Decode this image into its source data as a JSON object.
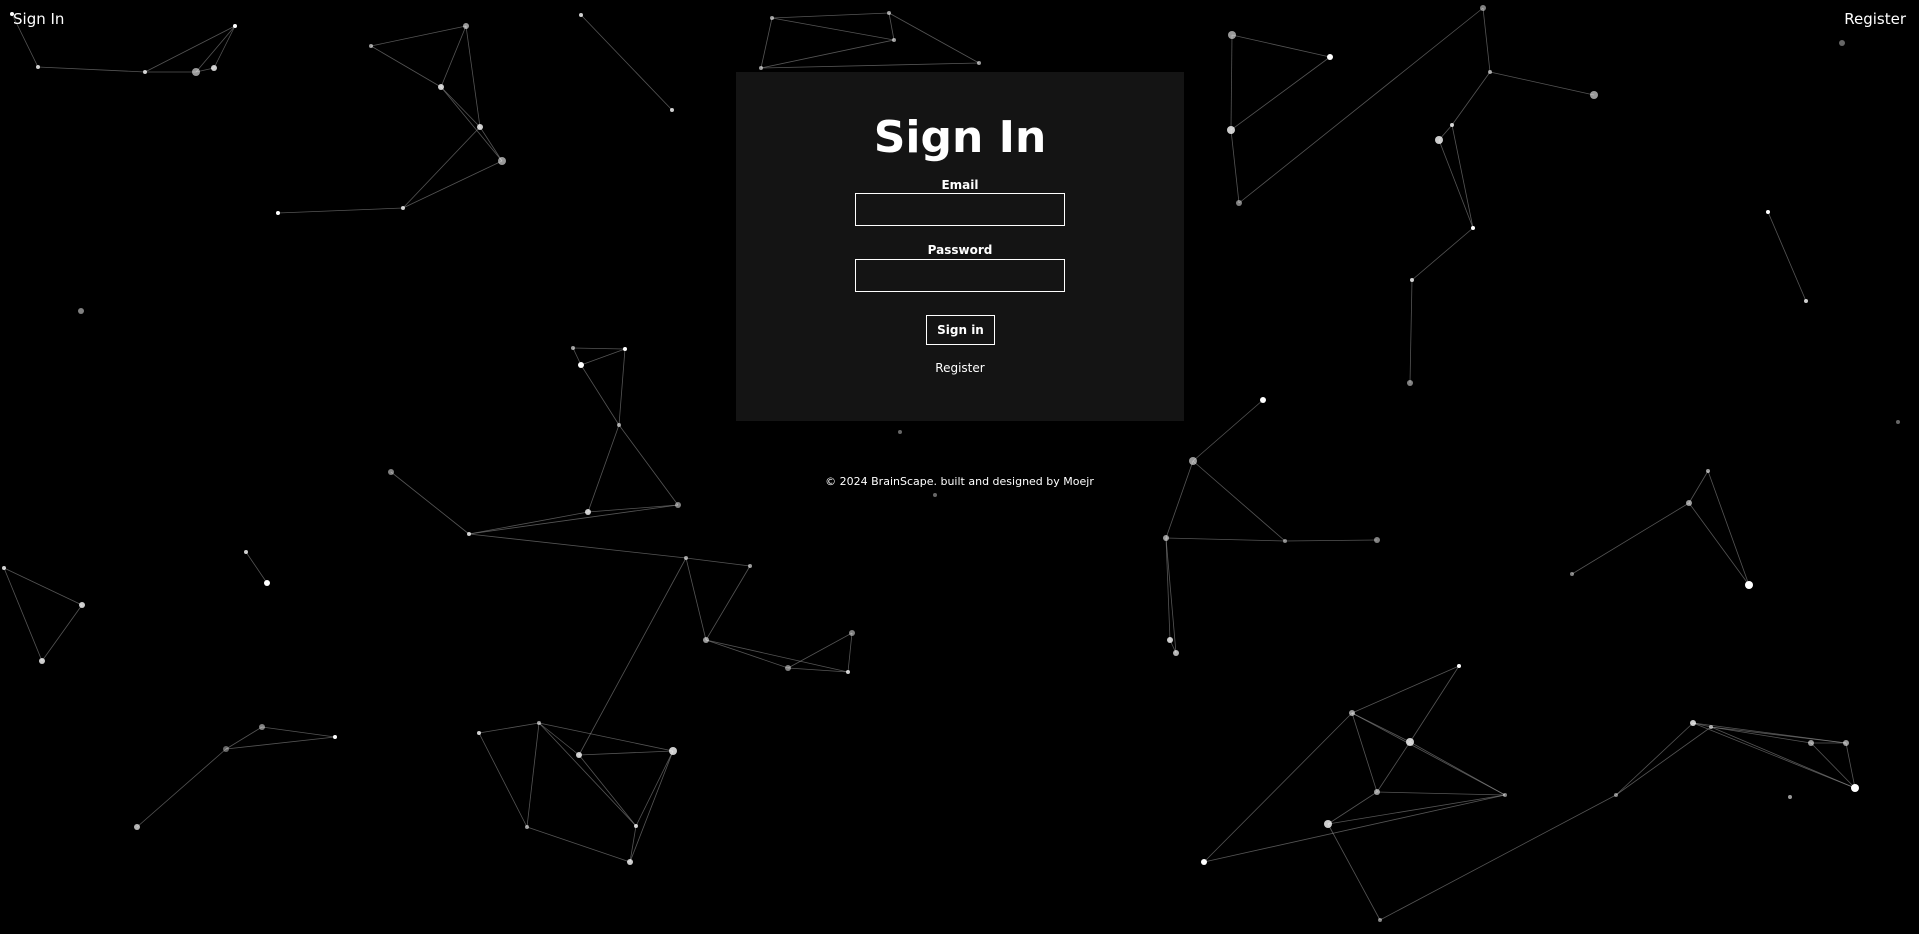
{
  "nav": {
    "sign_in": "Sign In",
    "register": "Register"
  },
  "form": {
    "title": "Sign In",
    "email_label": "Email",
    "email_value": "",
    "password_label": "Password",
    "password_value": "",
    "submit_label": "Sign in",
    "register_label": "Register"
  },
  "footer": {
    "text": "© 2024 BrainScape. built and designed by Moejr"
  },
  "colors": {
    "background": "#000000",
    "card": "#141414",
    "text": "#ffffff",
    "network": "#9a9a9a"
  }
}
